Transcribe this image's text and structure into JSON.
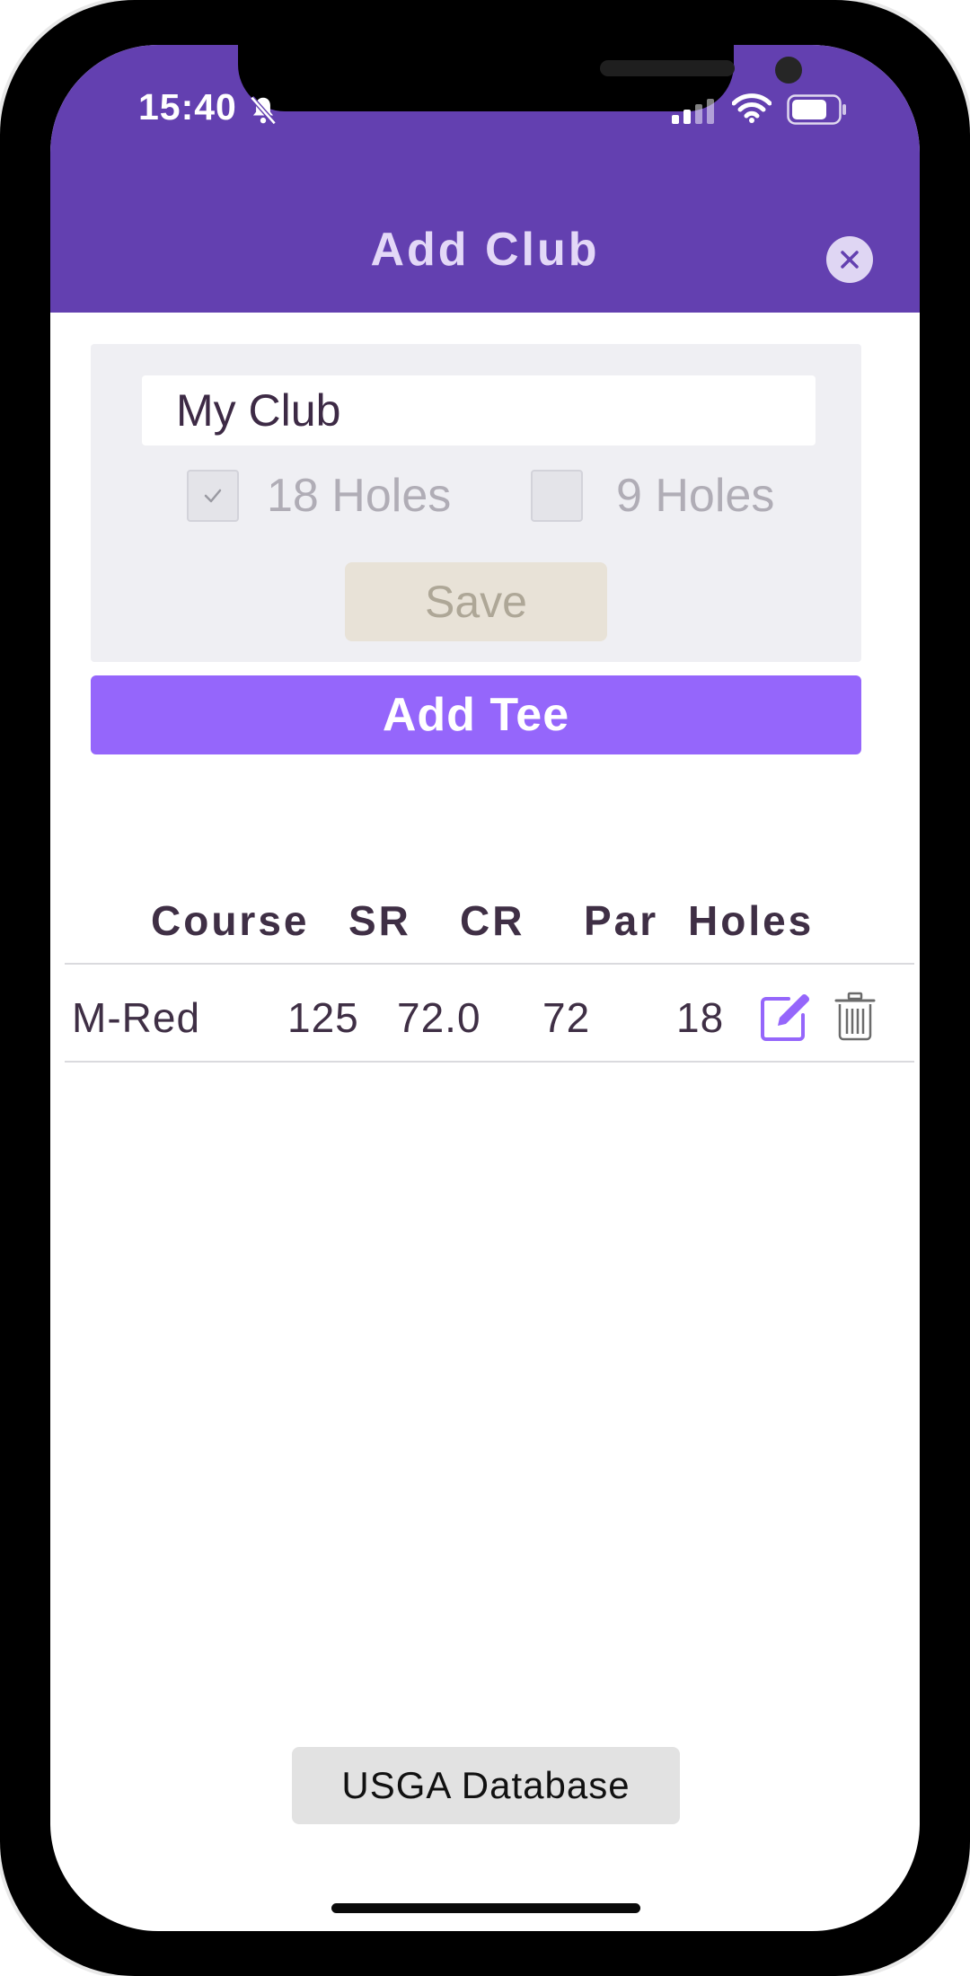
{
  "status_bar": {
    "time": "15:40",
    "icons": [
      "bell-slash-icon",
      "signal-icon",
      "wifi-icon",
      "battery-icon"
    ]
  },
  "header": {
    "title": "Add Club",
    "close_icon": "close-icon"
  },
  "form": {
    "club_name_value": "My Club",
    "club_name_placeholder": "",
    "holes_18_label": "18 Holes",
    "holes_18_checked": true,
    "holes_9_label": "9 Holes",
    "holes_9_checked": false,
    "save_label": "Save"
  },
  "add_tee_label": "Add Tee",
  "table": {
    "columns": [
      "Course",
      "SR",
      "CR",
      "Par",
      "Holes"
    ],
    "rows": [
      {
        "course": "M-Red",
        "sr": "125",
        "cr": "72.0",
        "par": "72",
        "holes": "18",
        "actions": [
          "edit-icon",
          "trash-icon"
        ]
      }
    ]
  },
  "usga_button_label": "USGA Database",
  "colors": {
    "header_bg": "#6340b0",
    "accent": "#9566fb",
    "text_dark": "#3f2f45"
  }
}
